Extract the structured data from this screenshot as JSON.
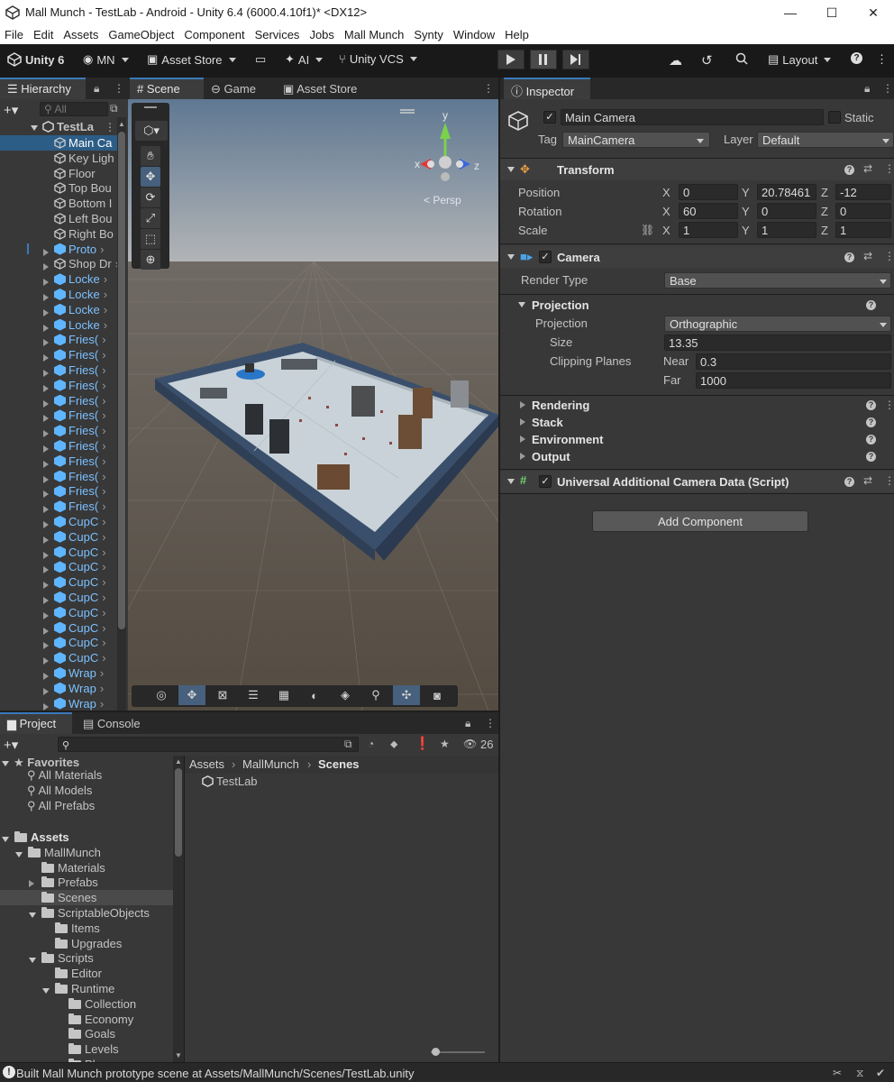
{
  "window": {
    "title": "Mall Munch - TestLab - Android - Unity 6.4 (6000.4.10f1)* <DX12>",
    "minimize": "—",
    "maximize": "☐",
    "close": "✕"
  },
  "menu": [
    "File",
    "Edit",
    "Assets",
    "GameObject",
    "Component",
    "Services",
    "Jobs",
    "Mall Munch",
    "Synty",
    "Window",
    "Help"
  ],
  "toolbar": {
    "unity_label": "Unity 6",
    "account": "MN",
    "asset_store": "Asset Store",
    "ai": "AI",
    "vcs": "Unity VCS",
    "layout": "Layout"
  },
  "hierarchy": {
    "tab": "Hierarchy",
    "search_placeholder": "All",
    "scene_name": "TestLa",
    "items": [
      {
        "label": "Main Ca",
        "blue": false,
        "arrow": false
      },
      {
        "label": "Key Ligh",
        "blue": false,
        "arrow": false
      },
      {
        "label": "Floor",
        "blue": false,
        "arrow": false
      },
      {
        "label": "Top Bou",
        "blue": false,
        "arrow": false
      },
      {
        "label": "Bottom I",
        "blue": false,
        "arrow": false
      },
      {
        "label": "Left Bou",
        "blue": false,
        "arrow": false
      },
      {
        "label": "Right Bo",
        "blue": false,
        "arrow": false
      },
      {
        "label": "Proto",
        "blue": true,
        "arrow": true
      },
      {
        "label": "Shop Dr",
        "blue": false,
        "arrow": true
      },
      {
        "label": "Locke",
        "blue": true,
        "arrow": true
      },
      {
        "label": "Locke",
        "blue": true,
        "arrow": true
      },
      {
        "label": "Locke",
        "blue": true,
        "arrow": true
      },
      {
        "label": "Locke",
        "blue": true,
        "arrow": true
      },
      {
        "label": "Fries(",
        "blue": true,
        "arrow": true
      },
      {
        "label": "Fries(",
        "blue": true,
        "arrow": true
      },
      {
        "label": "Fries(",
        "blue": true,
        "arrow": true
      },
      {
        "label": "Fries(",
        "blue": true,
        "arrow": true
      },
      {
        "label": "Fries(",
        "blue": true,
        "arrow": true
      },
      {
        "label": "Fries(",
        "blue": true,
        "arrow": true
      },
      {
        "label": "Fries(",
        "blue": true,
        "arrow": true
      },
      {
        "label": "Fries(",
        "blue": true,
        "arrow": true
      },
      {
        "label": "Fries(",
        "blue": true,
        "arrow": true
      },
      {
        "label": "Fries(",
        "blue": true,
        "arrow": true
      },
      {
        "label": "Fries(",
        "blue": true,
        "arrow": true
      },
      {
        "label": "Fries(",
        "blue": true,
        "arrow": true
      },
      {
        "label": "CupC",
        "blue": true,
        "arrow": true
      },
      {
        "label": "CupC",
        "blue": true,
        "arrow": true
      },
      {
        "label": "CupC",
        "blue": true,
        "arrow": true
      },
      {
        "label": "CupC",
        "blue": true,
        "arrow": true
      },
      {
        "label": "CupC",
        "blue": true,
        "arrow": true
      },
      {
        "label": "CupC",
        "blue": true,
        "arrow": true
      },
      {
        "label": "CupC",
        "blue": true,
        "arrow": true
      },
      {
        "label": "CupC",
        "blue": true,
        "arrow": true
      },
      {
        "label": "CupC",
        "blue": true,
        "arrow": true
      },
      {
        "label": "CupC",
        "blue": true,
        "arrow": true
      },
      {
        "label": "Wrap",
        "blue": true,
        "arrow": true
      },
      {
        "label": "Wrap",
        "blue": true,
        "arrow": true
      },
      {
        "label": "Wrap",
        "blue": true,
        "arrow": true
      }
    ]
  },
  "scene": {
    "tabs": [
      "Scene",
      "Game",
      "Asset Store"
    ],
    "persp": "Persp",
    "gizmo": {
      "x": "x",
      "y": "y",
      "z": "z"
    }
  },
  "inspector": {
    "tab": "Inspector",
    "name": "Main Camera",
    "static_label": "Static",
    "tag_label": "Tag",
    "tag_value": "MainCamera",
    "layer_label": "Layer",
    "layer_value": "Default",
    "transform": {
      "header": "Transform",
      "position_label": "Position",
      "rotation_label": "Rotation",
      "scale_label": "Scale",
      "position": {
        "x": "0",
        "y": "20.78461",
        "z": "-12"
      },
      "rotation": {
        "x": "60",
        "y": "0",
        "z": "0"
      },
      "scale": {
        "x": "1",
        "y": "1",
        "z": "1"
      },
      "axis_x": "X",
      "axis_y": "Y",
      "axis_z": "Z"
    },
    "camera": {
      "header": "Camera",
      "render_type_label": "Render Type",
      "render_type": "Base",
      "projection_section": "Projection",
      "projection_label": "Projection",
      "projection": "Orthographic",
      "size_label": "Size",
      "size": "13.35",
      "clipping_label": "Clipping Planes",
      "near_label": "Near",
      "near": "0.3",
      "far_label": "Far",
      "far": "1000",
      "rendering": "Rendering",
      "stack": "Stack",
      "environment": "Environment",
      "output": "Output"
    },
    "urp_header": "Universal Additional Camera Data (Script)",
    "add_component": "Add Component"
  },
  "project": {
    "tabs": [
      "Project",
      "Console"
    ],
    "count": "26",
    "breadcrumb": [
      "Assets",
      "MallMunch",
      "Scenes"
    ],
    "scene_file": "TestLab",
    "favorites": "Favorites",
    "fav_items": [
      "All Materials",
      "All Models",
      "All Prefabs"
    ],
    "tree": [
      {
        "label": "Assets",
        "indent": 0,
        "arrow": "down",
        "bold": true
      },
      {
        "label": "MallMunch",
        "indent": 1,
        "arrow": "down",
        "bold": false
      },
      {
        "label": "Materials",
        "indent": 2,
        "arrow": "none",
        "bold": false
      },
      {
        "label": "Prefabs",
        "indent": 2,
        "arrow": "right",
        "bold": false
      },
      {
        "label": "Scenes",
        "indent": 2,
        "arrow": "none",
        "bold": false,
        "selected": true
      },
      {
        "label": "ScriptableObjects",
        "indent": 2,
        "arrow": "down",
        "bold": false
      },
      {
        "label": "Items",
        "indent": 3,
        "arrow": "none",
        "bold": false
      },
      {
        "label": "Upgrades",
        "indent": 3,
        "arrow": "none",
        "bold": false
      },
      {
        "label": "Scripts",
        "indent": 2,
        "arrow": "down",
        "bold": false
      },
      {
        "label": "Editor",
        "indent": 3,
        "arrow": "none",
        "bold": false
      },
      {
        "label": "Runtime",
        "indent": 3,
        "arrow": "down",
        "bold": false
      },
      {
        "label": "Collection",
        "indent": 4,
        "arrow": "none",
        "bold": false
      },
      {
        "label": "Economy",
        "indent": 4,
        "arrow": "none",
        "bold": false
      },
      {
        "label": "Goals",
        "indent": 4,
        "arrow": "none",
        "bold": false
      },
      {
        "label": "Levels",
        "indent": 4,
        "arrow": "none",
        "bold": false
      },
      {
        "label": "Player",
        "indent": 4,
        "arrow": "none",
        "bold": false
      }
    ]
  },
  "status": "Built Mall Munch prototype scene at Assets/MallMunch/Scenes/TestLab.unity"
}
